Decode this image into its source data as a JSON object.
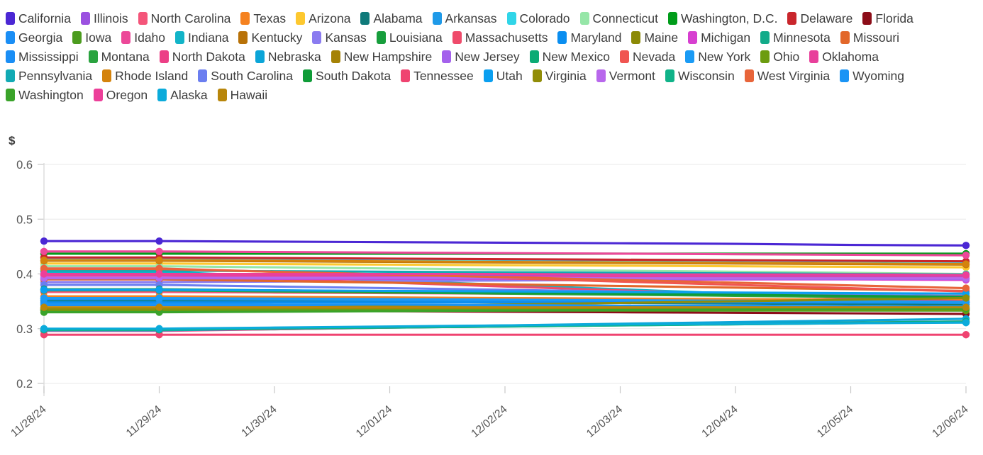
{
  "y_axis_title": "$",
  "chart_data": {
    "type": "line",
    "title": "",
    "subtitle": "",
    "xlabel": "",
    "ylabel": "$",
    "ylim": [
      0.2,
      0.6
    ],
    "yticks": [
      0.2,
      0.3,
      0.4,
      0.5,
      0.6
    ],
    "ytick_labels": [
      "0.2",
      "0.3",
      "0.4",
      "0.5",
      "0.6"
    ],
    "grid": true,
    "legend_position": "top",
    "x": [
      "11/28/24",
      "11/29/24",
      "11/30/24",
      "12/01/24",
      "12/02/24",
      "12/03/24",
      "12/04/24",
      "12/05/24",
      "12/06/24"
    ],
    "xtick_labels": [
      "11/28/24",
      "11/29/24",
      "11/30/24",
      "12/01/24",
      "12/02/24",
      "12/03/24",
      "12/04/24",
      "12/05/24",
      "12/06/24"
    ],
    "marker_indices": [
      0,
      1,
      8
    ],
    "series": [
      {
        "name": "California",
        "color": "#4b27d4",
        "values": [
          0.46,
          0.46,
          0.459,
          0.458,
          0.457,
          0.456,
          0.455,
          0.453,
          0.452
        ]
      },
      {
        "name": "Illinois",
        "color": "#9b51e0",
        "values": [
          0.399,
          0.399,
          0.399,
          0.398,
          0.398,
          0.397,
          0.397,
          0.396,
          0.396
        ]
      },
      {
        "name": "North Carolina",
        "color": "#f4557a",
        "values": [
          0.367,
          0.367,
          0.366,
          0.365,
          0.364,
          0.363,
          0.362,
          0.361,
          0.36
        ]
      },
      {
        "name": "Texas",
        "color": "#f58220",
        "values": [
          0.359,
          0.359,
          0.358,
          0.357,
          0.356,
          0.355,
          0.354,
          0.353,
          0.352
        ]
      },
      {
        "name": "Arizona",
        "color": "#fdc82f",
        "values": [
          0.419,
          0.419,
          0.418,
          0.417,
          0.416,
          0.415,
          0.414,
          0.413,
          0.412
        ]
      },
      {
        "name": "Alabama",
        "color": "#0f7a7a",
        "values": [
          0.351,
          0.351,
          0.35,
          0.349,
          0.348,
          0.347,
          0.346,
          0.345,
          0.344
        ]
      },
      {
        "name": "Arkansas",
        "color": "#1f9ae8",
        "values": [
          0.354,
          0.354,
          0.353,
          0.352,
          0.351,
          0.35,
          0.349,
          0.348,
          0.347
        ]
      },
      {
        "name": "Colorado",
        "color": "#30d5e8",
        "values": [
          0.429,
          0.429,
          0.428,
          0.427,
          0.426,
          0.425,
          0.424,
          0.423,
          0.422
        ]
      },
      {
        "name": "Connecticut",
        "color": "#96e6a8",
        "values": [
          0.414,
          0.414,
          0.412,
          0.41,
          0.408,
          0.406,
          0.404,
          0.402,
          0.4
        ]
      },
      {
        "name": "Washington, D.C.",
        "color": "#009c1a",
        "values": [
          0.437,
          0.437,
          0.437,
          0.437,
          0.437,
          0.437,
          0.437,
          0.437,
          0.437
        ]
      },
      {
        "name": "Delaware",
        "color": "#c9262c",
        "values": [
          0.43,
          0.43,
          0.429,
          0.428,
          0.427,
          0.426,
          0.425,
          0.424,
          0.423
        ]
      },
      {
        "name": "Florida",
        "color": "#8c0d18",
        "values": [
          0.334,
          0.334,
          0.333,
          0.332,
          0.331,
          0.33,
          0.329,
          0.328,
          0.327
        ]
      },
      {
        "name": "Georgia",
        "color": "#1a8ef5",
        "values": [
          0.343,
          0.343,
          0.342,
          0.341,
          0.34,
          0.339,
          0.338,
          0.337,
          0.336
        ]
      },
      {
        "name": "Iowa",
        "color": "#4c9c1f",
        "values": [
          0.333,
          0.333,
          0.333,
          0.333,
          0.333,
          0.333,
          0.333,
          0.333,
          0.333
        ]
      },
      {
        "name": "Idaho",
        "color": "#ec4899",
        "values": [
          0.441,
          0.441,
          0.44,
          0.439,
          0.438,
          0.437,
          0.436,
          0.435,
          0.434
        ]
      },
      {
        "name": "Indiana",
        "color": "#12b4c8",
        "values": [
          0.404,
          0.404,
          0.396,
          0.388,
          0.38,
          0.372,
          0.364,
          0.356,
          0.348
        ]
      },
      {
        "name": "Kentucky",
        "color": "#b87208",
        "values": [
          0.424,
          0.424,
          0.423,
          0.422,
          0.421,
          0.42,
          0.419,
          0.418,
          0.417
        ]
      },
      {
        "name": "Kansas",
        "color": "#8a7bf0",
        "values": [
          0.385,
          0.385,
          0.386,
          0.387,
          0.388,
          0.389,
          0.39,
          0.391,
          0.392
        ]
      },
      {
        "name": "Louisiana",
        "color": "#179e3c",
        "values": [
          0.335,
          0.335,
          0.335,
          0.335,
          0.335,
          0.335,
          0.335,
          0.335,
          0.335
        ]
      },
      {
        "name": "Massachusetts",
        "color": "#ef4b6b",
        "values": [
          0.398,
          0.398,
          0.391,
          0.384,
          0.377,
          0.37,
          0.363,
          0.356,
          0.35
        ]
      },
      {
        "name": "Maryland",
        "color": "#0a8ef0",
        "values": [
          0.348,
          0.348,
          0.348,
          0.348,
          0.348,
          0.348,
          0.348,
          0.348,
          0.348
        ]
      },
      {
        "name": "Maine",
        "color": "#8c8a06",
        "values": [
          0.338,
          0.338,
          0.338,
          0.338,
          0.338,
          0.338,
          0.338,
          0.338,
          0.338
        ]
      },
      {
        "name": "Michigan",
        "color": "#d73fd0",
        "values": [
          0.391,
          0.391,
          0.391,
          0.391,
          0.391,
          0.39,
          0.39,
          0.39,
          0.389
        ]
      },
      {
        "name": "Minnesota",
        "color": "#12ab8a",
        "values": [
          0.297,
          0.297,
          0.299,
          0.302,
          0.304,
          0.306,
          0.308,
          0.31,
          0.312
        ]
      },
      {
        "name": "Missouri",
        "color": "#e2672a",
        "values": [
          0.39,
          0.39,
          0.387,
          0.384,
          0.381,
          0.378,
          0.375,
          0.372,
          0.369
        ]
      },
      {
        "name": "Mississippi",
        "color": "#1a8ef5",
        "values": [
          0.355,
          0.355,
          0.354,
          0.353,
          0.352,
          0.351,
          0.35,
          0.349,
          0.348
        ]
      },
      {
        "name": "Montana",
        "color": "#2aa33f",
        "values": [
          0.37,
          0.37,
          0.368,
          0.366,
          0.364,
          0.362,
          0.36,
          0.358,
          0.356
        ]
      },
      {
        "name": "North Dakota",
        "color": "#ec3f86",
        "values": [
          0.296,
          0.296,
          0.299,
          0.302,
          0.305,
          0.307,
          0.309,
          0.311,
          0.313
        ]
      },
      {
        "name": "Nebraska",
        "color": "#0ba5d8",
        "values": [
          0.297,
          0.297,
          0.3,
          0.303,
          0.306,
          0.309,
          0.312,
          0.315,
          0.318
        ]
      },
      {
        "name": "New Hampshire",
        "color": "#a58205",
        "values": [
          0.337,
          0.337,
          0.337,
          0.337,
          0.337,
          0.337,
          0.337,
          0.337,
          0.337
        ]
      },
      {
        "name": "New Jersey",
        "color": "#a461ec",
        "values": [
          0.392,
          0.392,
          0.392,
          0.392,
          0.392,
          0.391,
          0.391,
          0.391,
          0.391
        ]
      },
      {
        "name": "New Mexico",
        "color": "#0bab74",
        "values": [
          0.299,
          0.299,
          0.301,
          0.303,
          0.305,
          0.307,
          0.309,
          0.311,
          0.313
        ]
      },
      {
        "name": "Nevada",
        "color": "#f05551",
        "values": [
          0.41,
          0.41,
          0.404,
          0.398,
          0.392,
          0.386,
          0.38,
          0.374,
          0.368
        ]
      },
      {
        "name": "New York",
        "color": "#1a9bf5",
        "values": [
          0.356,
          0.356,
          0.355,
          0.354,
          0.353,
          0.352,
          0.351,
          0.35,
          0.349
        ]
      },
      {
        "name": "Ohio",
        "color": "#6c9c10",
        "values": [
          0.334,
          0.334,
          0.334,
          0.334,
          0.334,
          0.334,
          0.334,
          0.334,
          0.334
        ]
      },
      {
        "name": "Oklahoma",
        "color": "#e8409b",
        "values": [
          0.397,
          0.397,
          0.396,
          0.396,
          0.395,
          0.395,
          0.394,
          0.394,
          0.393
        ]
      },
      {
        "name": "Pennsylvania",
        "color": "#12aab4",
        "values": [
          0.406,
          0.406,
          0.405,
          0.404,
          0.403,
          0.402,
          0.401,
          0.4,
          0.399
        ]
      },
      {
        "name": "Rhode Island",
        "color": "#d4830d",
        "values": [
          0.425,
          0.425,
          0.424,
          0.423,
          0.422,
          0.421,
          0.42,
          0.419,
          0.418
        ]
      },
      {
        "name": "South Carolina",
        "color": "#6b7ef0",
        "values": [
          0.38,
          0.38,
          0.377,
          0.374,
          0.371,
          0.368,
          0.365,
          0.362,
          0.359
        ]
      },
      {
        "name": "South Dakota",
        "color": "#0f9c38",
        "values": [
          0.372,
          0.372,
          0.37,
          0.368,
          0.366,
          0.364,
          0.362,
          0.36,
          0.358
        ]
      },
      {
        "name": "Tennessee",
        "color": "#ef4370",
        "values": [
          0.289,
          0.289,
          0.289,
          0.289,
          0.289,
          0.289,
          0.289,
          0.289,
          0.289
        ]
      },
      {
        "name": "Utah",
        "color": "#0a9ff0",
        "values": [
          0.371,
          0.371,
          0.37,
          0.369,
          0.368,
          0.367,
          0.366,
          0.365,
          0.364
        ]
      },
      {
        "name": "Virginia",
        "color": "#918d08",
        "values": [
          0.336,
          0.336,
          0.338,
          0.341,
          0.344,
          0.347,
          0.35,
          0.353,
          0.356
        ]
      },
      {
        "name": "Vermont",
        "color": "#b867ec",
        "values": [
          0.393,
          0.393,
          0.393,
          0.393,
          0.393,
          0.392,
          0.392,
          0.392,
          0.392
        ]
      },
      {
        "name": "Wisconsin",
        "color": "#10b389",
        "values": [
          0.298,
          0.298,
          0.3,
          0.302,
          0.304,
          0.306,
          0.308,
          0.31,
          0.312
        ]
      },
      {
        "name": "West Virginia",
        "color": "#e8653a",
        "values": [
          0.409,
          0.409,
          0.404,
          0.399,
          0.394,
          0.389,
          0.384,
          0.379,
          0.374
        ]
      },
      {
        "name": "Wyoming",
        "color": "#1a94f5",
        "values": [
          0.345,
          0.345,
          0.344,
          0.344,
          0.343,
          0.342,
          0.342,
          0.341,
          0.34
        ]
      },
      {
        "name": "Washington",
        "color": "#3aa32a",
        "values": [
          0.33,
          0.33,
          0.331,
          0.332,
          0.333,
          0.334,
          0.335,
          0.336,
          0.337
        ]
      },
      {
        "name": "Oregon",
        "color": "#ec3f99",
        "values": [
          0.4,
          0.4,
          0.4,
          0.4,
          0.4,
          0.399,
          0.399,
          0.399,
          0.398
        ]
      },
      {
        "name": "Alaska",
        "color": "#0babdb",
        "values": [
          0.3,
          0.3,
          0.302,
          0.304,
          0.306,
          0.308,
          0.309,
          0.31,
          0.311
        ]
      },
      {
        "name": "Hawaii",
        "color": "#b8860b",
        "values": [
          0.339,
          0.339,
          0.339,
          0.339,
          0.339,
          0.339,
          0.339,
          0.339,
          0.339
        ]
      }
    ]
  }
}
